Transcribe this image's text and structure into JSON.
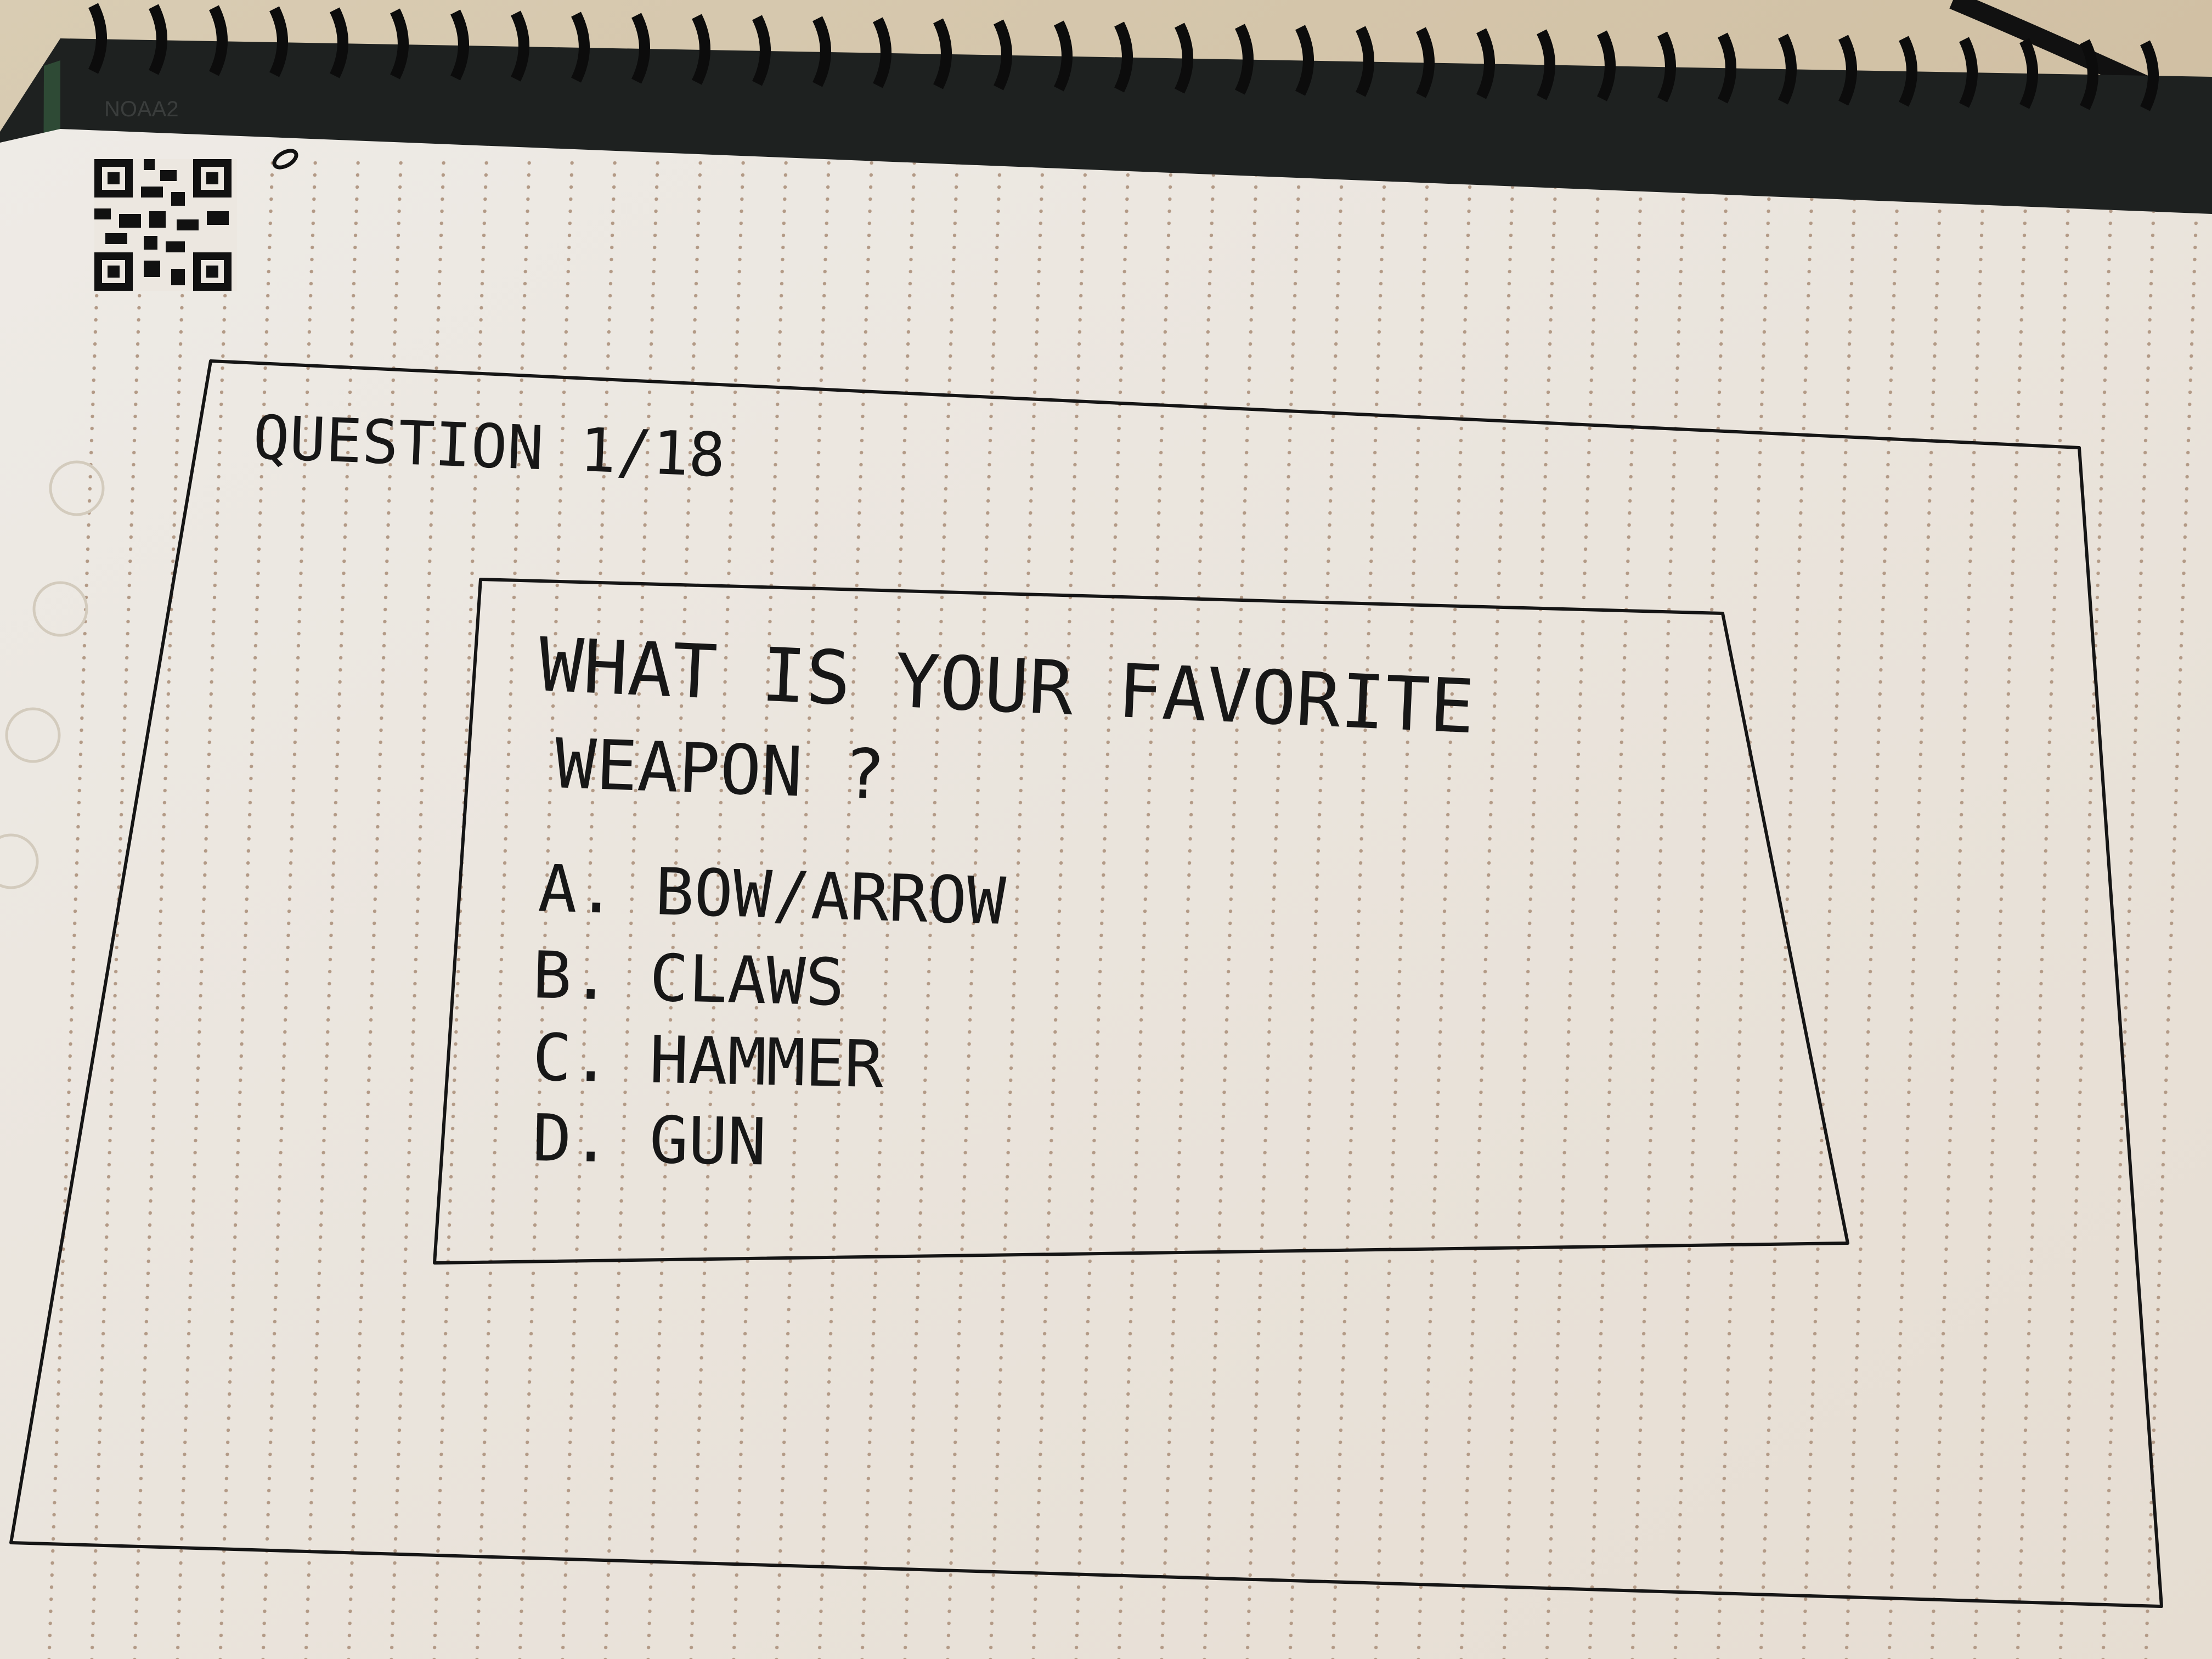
{
  "notebook": {
    "brand_mark": "NOAA2",
    "page": {
      "question_counter": "QUESTION 1/18",
      "question_text_line1": "WHAT IS YOUR FAVORITE",
      "question_text_line2": "WEAPON ?",
      "options": [
        {
          "label": "A. BOW/ARROW"
        },
        {
          "label": "B. CLAWS"
        },
        {
          "label": "C. HAMMER"
        },
        {
          "label": "D. GUN"
        }
      ]
    }
  },
  "colors": {
    "desk": "#d6c6ac",
    "paper": "#ece7e0",
    "cover": "#1e2120",
    "ink": "#171717",
    "dots": "#b39a86"
  },
  "icons": [
    "qr-code-icon",
    "pen-icon"
  ]
}
